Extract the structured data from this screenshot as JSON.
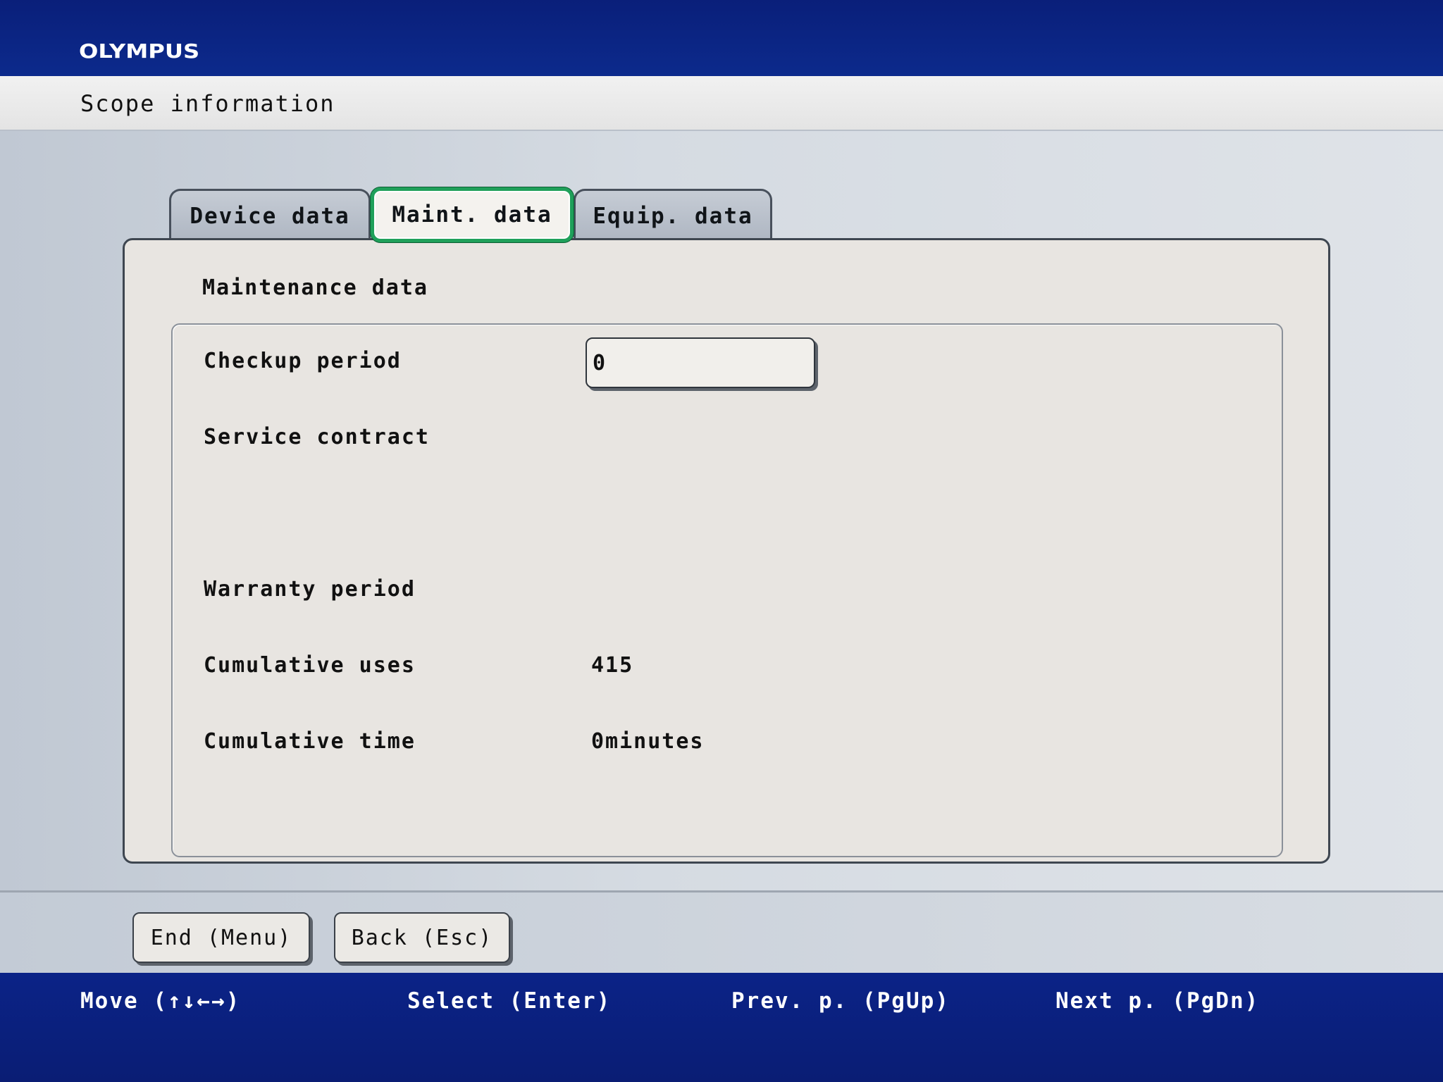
{
  "header": {
    "brand": "OLYMPUS",
    "title": "Scope information"
  },
  "tabs": [
    {
      "label": "Device data",
      "selected": false
    },
    {
      "label": "Maint. data",
      "selected": true
    },
    {
      "label": "Equip. data",
      "selected": false
    }
  ],
  "panel": {
    "title": "Maintenance data",
    "rows": {
      "checkup_period": {
        "label": "Checkup period",
        "value": "0"
      },
      "service_contract": {
        "label": "Service contract"
      },
      "warranty_period": {
        "label": "Warranty period"
      },
      "cumulative_uses": {
        "label": "Cumulative uses",
        "value": "415"
      },
      "cumulative_time": {
        "label": "Cumulative time",
        "value": "0minutes"
      }
    }
  },
  "buttons": {
    "end": "End (Menu)",
    "back": "Back (Esc)"
  },
  "hints": {
    "move": "Move (↑↓←→)",
    "select": "Select (Enter)",
    "prev": "Prev. p. (PgUp)",
    "next": "Next p. (PgDn)"
  },
  "colors": {
    "header_blue": "#0c2a8c",
    "selection_green": "#1fa05a",
    "panel_bg": "#e8e5e1"
  }
}
